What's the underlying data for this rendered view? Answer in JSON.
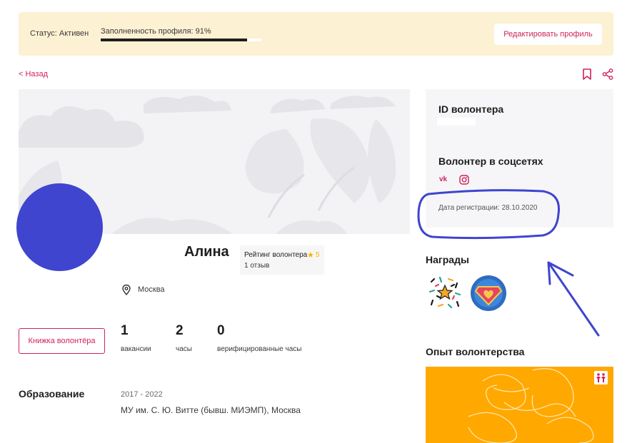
{
  "status": {
    "status_text": "Статус: Активен",
    "progress_label": "Заполненность профиля: 91%",
    "progress_value": 0.91,
    "edit_button": "Редактировать профиль"
  },
  "nav": {
    "back_label": "< Назад"
  },
  "profile": {
    "name": "Алина",
    "rating_label": "Рейтинг волонтера",
    "rating_value": "5",
    "reviews": "1 отзыв",
    "city": "Москва"
  },
  "book_button": "Книжка волонтёра",
  "stats": [
    {
      "value": "1",
      "label": "вакансии"
    },
    {
      "value": "2",
      "label": "часы"
    },
    {
      "value": "0",
      "label": "верифицированные часы"
    }
  ],
  "education": {
    "title": "Образование",
    "years": "2017 - 2022",
    "institution": "МУ им. С. Ю. Витте (бывш. МИЭМП), Москва"
  },
  "sidebar": {
    "id_title": "ID волонтера",
    "social_title": "Волонтер в соцсетях",
    "social_icons": [
      "vk-icon",
      "instagram-icon"
    ],
    "registration": "Дата регистрации: 28.10.2020"
  },
  "awards": {
    "title": "Награды",
    "items": [
      "confetti-star-award-icon",
      "superhero-heart-award-icon"
    ]
  },
  "experience": {
    "title": "Опыт волонтерства"
  },
  "colors": {
    "accent": "#d0215c",
    "status_bg": "#fdf1d3",
    "avatar": "#3f45cf",
    "experience_card": "#ffa800",
    "annotation": "#3f45cf"
  }
}
